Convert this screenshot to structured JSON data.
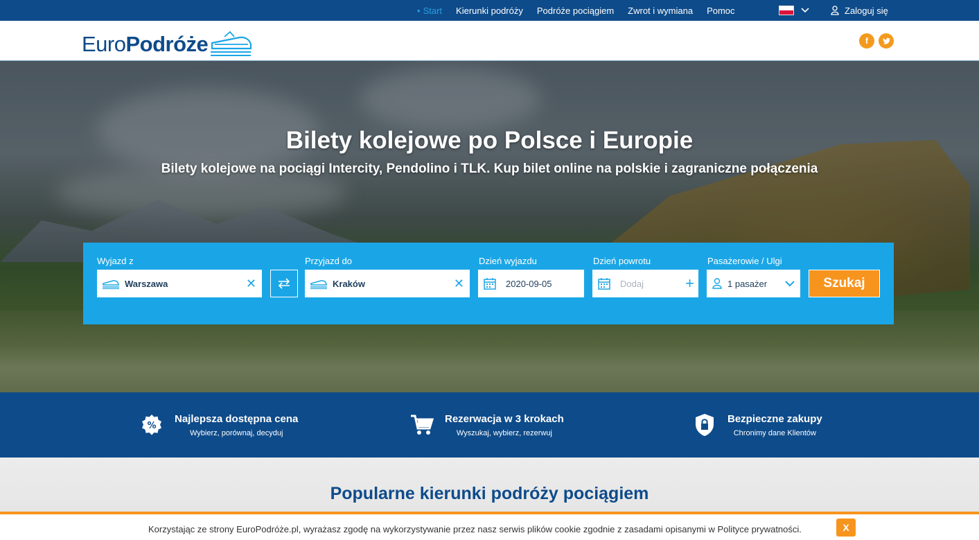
{
  "topnav": {
    "items": [
      "Start",
      "Kierunki podróży",
      "Podróże pociągiem",
      "Zwrot i wymiana",
      "Pomoc"
    ],
    "login": "Zaloguj się"
  },
  "header": {
    "logo_part1": "Euro",
    "logo_part2": "Podróże",
    "social": [
      "f",
      "t"
    ]
  },
  "hero": {
    "title": "Bilety kolejowe po Polsce i Europie",
    "subtitle": "Bilety kolejowe na pociągi Intercity, Pendolino i TLK. Kup bilet online na polskie i zagraniczne połączenia"
  },
  "search": {
    "from_label": "Wyjazd z",
    "from_value": "Warszawa",
    "to_label": "Przyjazd do",
    "to_value": "Kraków",
    "depart_label": "Dzień wyjazdu",
    "depart_value": "2020-09-05",
    "return_label": "Dzień powrotu",
    "return_placeholder": "Dodaj",
    "passengers_label": "Pasażerowie / Ulgi",
    "passengers_value": "1 pasażer",
    "button": "Szukaj"
  },
  "features": [
    {
      "title": "Najlepsza dostępna cena",
      "sub": "Wybierz, porównaj, decyduj"
    },
    {
      "title": "Rezerwacja w 3 krokach",
      "sub": "Wyszukaj, wybierz, rezerwuj"
    },
    {
      "title": "Bezpieczne zakupy",
      "sub": "Chronimy dane Klientów"
    }
  ],
  "popular": {
    "title": "Popularne kierunki podróży pociągiem"
  },
  "cookie": {
    "text": "Korzystając ze strony EuroPodróże.pl, wyrażasz zgodę na wykorzystywanie przez nasz serwis plików cookie zgodnie z zasadami opisanymi w Polityce prywatności.",
    "close": "X"
  },
  "colors": {
    "navy": "#0e4b8a",
    "accent_blue": "#1aa6e6",
    "orange": "#f7941e"
  },
  "icons": [
    "user-icon",
    "train-icon",
    "swap-icon",
    "calendar-icon",
    "chevron-down-icon",
    "percent-badge-icon",
    "cart-icon",
    "shield-lock-icon"
  ]
}
